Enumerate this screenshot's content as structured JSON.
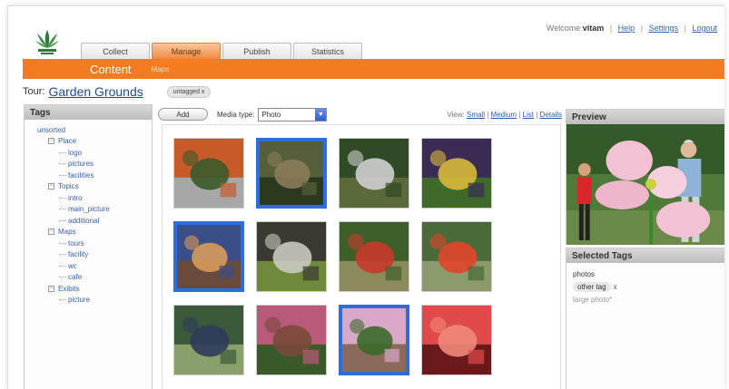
{
  "header": {
    "welcome_prefix": "Welcome",
    "user": "vitam",
    "links": [
      "Help",
      "Settings",
      "Logout"
    ]
  },
  "tabs": [
    {
      "label": "Collect",
      "active": false
    },
    {
      "label": "Manage",
      "active": true
    },
    {
      "label": "Publish",
      "active": false
    },
    {
      "label": "Statistics",
      "active": false
    }
  ],
  "section": {
    "title": "Content",
    "sub_link": "Maps"
  },
  "tour": {
    "label": "Tour:",
    "name": "Garden Grounds",
    "filter_chip": "untagged",
    "chip_close": "x"
  },
  "tags_panel": {
    "title": "Tags",
    "tree": [
      {
        "label": "unsorted",
        "level": 0
      },
      {
        "label": "Place",
        "level": 1
      },
      {
        "label": "logo",
        "level": 2
      },
      {
        "label": "pictures",
        "level": 2
      },
      {
        "label": "facilities",
        "level": 2
      },
      {
        "label": "Topics",
        "level": 1
      },
      {
        "label": "intro",
        "level": 2
      },
      {
        "label": "main_picture",
        "level": 2
      },
      {
        "label": "additional",
        "level": 2
      },
      {
        "label": "Maps",
        "level": 1
      },
      {
        "label": "tours",
        "level": 2
      },
      {
        "label": "facility",
        "level": 2
      },
      {
        "label": "wc",
        "level": 2
      },
      {
        "label": "cafe",
        "level": 2
      },
      {
        "label": "Exibits",
        "level": 1
      },
      {
        "label": "picture",
        "level": 2
      }
    ],
    "expander": "⊟"
  },
  "toolbar": {
    "add_label": "Add",
    "media_label": "Media type:",
    "media_value": "Photo",
    "dropdown_arrow": "▼",
    "view_label": "View:",
    "view_options": [
      "Small",
      "Medium",
      "List",
      "Details"
    ],
    "separator": "|"
  },
  "thumbnails": [
    {
      "name": "thumb-autumn-bench",
      "selected": false,
      "colors": [
        "#c85a2a",
        "#3b5b2a",
        "#a7a7a7"
      ]
    },
    {
      "name": "thumb-garden-arch",
      "selected": true,
      "colors": [
        "#55603a",
        "#8b7b58",
        "#2b3a1e"
      ]
    },
    {
      "name": "thumb-path-people",
      "selected": false,
      "colors": [
        "#2f4a24",
        "#cfcfcf",
        "#5a6a3a"
      ]
    },
    {
      "name": "thumb-flower-sculpture",
      "selected": false,
      "colors": [
        "#3a2c55",
        "#d8b938",
        "#3f6a2a"
      ]
    },
    {
      "name": "thumb-child-closeup",
      "selected": true,
      "colors": [
        "#3a4f88",
        "#d79a5a",
        "#6a4a3a"
      ]
    },
    {
      "name": "thumb-garden-stall",
      "selected": false,
      "colors": [
        "#3a3a30",
        "#c9c9c0",
        "#6f8a3a"
      ]
    },
    {
      "name": "thumb-flower-beds",
      "selected": false,
      "colors": [
        "#3f5f2a",
        "#c63a2a",
        "#8a8a5a"
      ]
    },
    {
      "name": "thumb-red-flowers",
      "selected": false,
      "colors": [
        "#4a6a3a",
        "#e0452a",
        "#8a9a6a"
      ]
    },
    {
      "name": "thumb-topiary",
      "selected": false,
      "colors": [
        "#3a5a3a",
        "#2f3a5a",
        "#8aa06a"
      ]
    },
    {
      "name": "thumb-girl-flower",
      "selected": false,
      "colors": [
        "#b95a7a",
        "#7a4a3a",
        "#3a5a2a"
      ]
    },
    {
      "name": "thumb-pink-flower",
      "selected": true,
      "colors": [
        "#d9a8c8",
        "#3a6a2a",
        "#8a6a5a"
      ]
    },
    {
      "name": "thumb-rose",
      "selected": false,
      "colors": [
        "#e04a4a",
        "#f08a7a",
        "#6a1a1a"
      ]
    }
  ],
  "preview": {
    "title": "Preview"
  },
  "selected_tags": {
    "title": "Selected Tags",
    "items": [
      {
        "label": "photos",
        "removable": false
      },
      {
        "label": "other tag",
        "removable": true
      },
      {
        "label": "large photo*",
        "removable": false,
        "hint": true
      }
    ],
    "remove_glyph": "x"
  },
  "colors": {
    "accent": "#f47b20",
    "selection": "#2e6de0",
    "link": "#1a4c99"
  }
}
